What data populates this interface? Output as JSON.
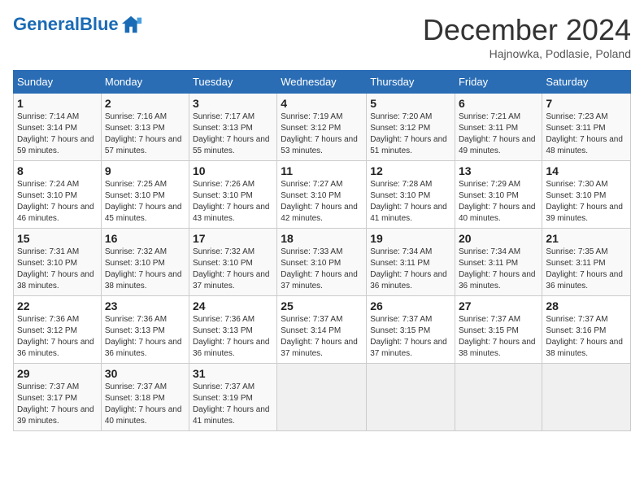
{
  "logo": {
    "text_general": "General",
    "text_blue": "Blue"
  },
  "header": {
    "month": "December 2024",
    "location": "Hajnowka, Podlasie, Poland"
  },
  "weekdays": [
    "Sunday",
    "Monday",
    "Tuesday",
    "Wednesday",
    "Thursday",
    "Friday",
    "Saturday"
  ],
  "weeks": [
    [
      {
        "day": "1",
        "sunrise": "Sunrise: 7:14 AM",
        "sunset": "Sunset: 3:14 PM",
        "daylight": "Daylight: 7 hours and 59 minutes."
      },
      {
        "day": "2",
        "sunrise": "Sunrise: 7:16 AM",
        "sunset": "Sunset: 3:13 PM",
        "daylight": "Daylight: 7 hours and 57 minutes."
      },
      {
        "day": "3",
        "sunrise": "Sunrise: 7:17 AM",
        "sunset": "Sunset: 3:13 PM",
        "daylight": "Daylight: 7 hours and 55 minutes."
      },
      {
        "day": "4",
        "sunrise": "Sunrise: 7:19 AM",
        "sunset": "Sunset: 3:12 PM",
        "daylight": "Daylight: 7 hours and 53 minutes."
      },
      {
        "day": "5",
        "sunrise": "Sunrise: 7:20 AM",
        "sunset": "Sunset: 3:12 PM",
        "daylight": "Daylight: 7 hours and 51 minutes."
      },
      {
        "day": "6",
        "sunrise": "Sunrise: 7:21 AM",
        "sunset": "Sunset: 3:11 PM",
        "daylight": "Daylight: 7 hours and 49 minutes."
      },
      {
        "day": "7",
        "sunrise": "Sunrise: 7:23 AM",
        "sunset": "Sunset: 3:11 PM",
        "daylight": "Daylight: 7 hours and 48 minutes."
      }
    ],
    [
      {
        "day": "8",
        "sunrise": "Sunrise: 7:24 AM",
        "sunset": "Sunset: 3:10 PM",
        "daylight": "Daylight: 7 hours and 46 minutes."
      },
      {
        "day": "9",
        "sunrise": "Sunrise: 7:25 AM",
        "sunset": "Sunset: 3:10 PM",
        "daylight": "Daylight: 7 hours and 45 minutes."
      },
      {
        "day": "10",
        "sunrise": "Sunrise: 7:26 AM",
        "sunset": "Sunset: 3:10 PM",
        "daylight": "Daylight: 7 hours and 43 minutes."
      },
      {
        "day": "11",
        "sunrise": "Sunrise: 7:27 AM",
        "sunset": "Sunset: 3:10 PM",
        "daylight": "Daylight: 7 hours and 42 minutes."
      },
      {
        "day": "12",
        "sunrise": "Sunrise: 7:28 AM",
        "sunset": "Sunset: 3:10 PM",
        "daylight": "Daylight: 7 hours and 41 minutes."
      },
      {
        "day": "13",
        "sunrise": "Sunrise: 7:29 AM",
        "sunset": "Sunset: 3:10 PM",
        "daylight": "Daylight: 7 hours and 40 minutes."
      },
      {
        "day": "14",
        "sunrise": "Sunrise: 7:30 AM",
        "sunset": "Sunset: 3:10 PM",
        "daylight": "Daylight: 7 hours and 39 minutes."
      }
    ],
    [
      {
        "day": "15",
        "sunrise": "Sunrise: 7:31 AM",
        "sunset": "Sunset: 3:10 PM",
        "daylight": "Daylight: 7 hours and 38 minutes."
      },
      {
        "day": "16",
        "sunrise": "Sunrise: 7:32 AM",
        "sunset": "Sunset: 3:10 PM",
        "daylight": "Daylight: 7 hours and 38 minutes."
      },
      {
        "day": "17",
        "sunrise": "Sunrise: 7:32 AM",
        "sunset": "Sunset: 3:10 PM",
        "daylight": "Daylight: 7 hours and 37 minutes."
      },
      {
        "day": "18",
        "sunrise": "Sunrise: 7:33 AM",
        "sunset": "Sunset: 3:10 PM",
        "daylight": "Daylight: 7 hours and 37 minutes."
      },
      {
        "day": "19",
        "sunrise": "Sunrise: 7:34 AM",
        "sunset": "Sunset: 3:11 PM",
        "daylight": "Daylight: 7 hours and 36 minutes."
      },
      {
        "day": "20",
        "sunrise": "Sunrise: 7:34 AM",
        "sunset": "Sunset: 3:11 PM",
        "daylight": "Daylight: 7 hours and 36 minutes."
      },
      {
        "day": "21",
        "sunrise": "Sunrise: 7:35 AM",
        "sunset": "Sunset: 3:11 PM",
        "daylight": "Daylight: 7 hours and 36 minutes."
      }
    ],
    [
      {
        "day": "22",
        "sunrise": "Sunrise: 7:36 AM",
        "sunset": "Sunset: 3:12 PM",
        "daylight": "Daylight: 7 hours and 36 minutes."
      },
      {
        "day": "23",
        "sunrise": "Sunrise: 7:36 AM",
        "sunset": "Sunset: 3:13 PM",
        "daylight": "Daylight: 7 hours and 36 minutes."
      },
      {
        "day": "24",
        "sunrise": "Sunrise: 7:36 AM",
        "sunset": "Sunset: 3:13 PM",
        "daylight": "Daylight: 7 hours and 36 minutes."
      },
      {
        "day": "25",
        "sunrise": "Sunrise: 7:37 AM",
        "sunset": "Sunset: 3:14 PM",
        "daylight": "Daylight: 7 hours and 37 minutes."
      },
      {
        "day": "26",
        "sunrise": "Sunrise: 7:37 AM",
        "sunset": "Sunset: 3:15 PM",
        "daylight": "Daylight: 7 hours and 37 minutes."
      },
      {
        "day": "27",
        "sunrise": "Sunrise: 7:37 AM",
        "sunset": "Sunset: 3:15 PM",
        "daylight": "Daylight: 7 hours and 38 minutes."
      },
      {
        "day": "28",
        "sunrise": "Sunrise: 7:37 AM",
        "sunset": "Sunset: 3:16 PM",
        "daylight": "Daylight: 7 hours and 38 minutes."
      }
    ],
    [
      {
        "day": "29",
        "sunrise": "Sunrise: 7:37 AM",
        "sunset": "Sunset: 3:17 PM",
        "daylight": "Daylight: 7 hours and 39 minutes."
      },
      {
        "day": "30",
        "sunrise": "Sunrise: 7:37 AM",
        "sunset": "Sunset: 3:18 PM",
        "daylight": "Daylight: 7 hours and 40 minutes."
      },
      {
        "day": "31",
        "sunrise": "Sunrise: 7:37 AM",
        "sunset": "Sunset: 3:19 PM",
        "daylight": "Daylight: 7 hours and 41 minutes."
      },
      null,
      null,
      null,
      null
    ]
  ]
}
